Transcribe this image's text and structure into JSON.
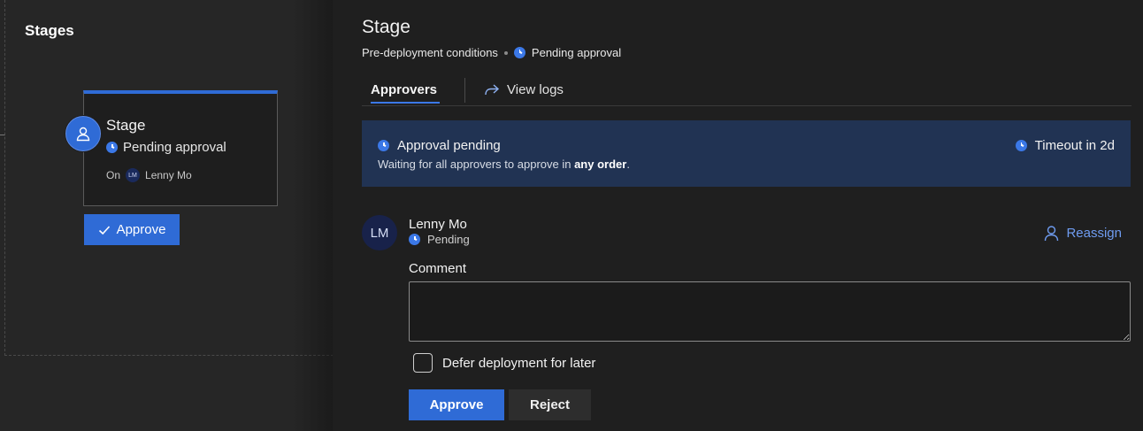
{
  "stages": {
    "title": "Stages",
    "card": {
      "name": "Stage",
      "status": "Pending approval",
      "on_label": "On",
      "user_initials": "LM",
      "user_name": "Lenny Mo"
    },
    "approve_button": "Approve"
  },
  "panel": {
    "title": "Stage",
    "breadcrumb": {
      "conditions": "Pre-deployment conditions",
      "status": "Pending approval"
    },
    "tabs": [
      {
        "label": "Approvers",
        "selected": true
      },
      {
        "label": "View logs",
        "selected": false
      }
    ],
    "banner": {
      "title": "Approval pending",
      "subtitle_prefix": "Waiting for all approvers to approve in ",
      "subtitle_bold": "any order",
      "subtitle_suffix": ".",
      "timeout": "Timeout in 2d"
    },
    "approver": {
      "initials": "LM",
      "name": "Lenny Mo",
      "status": "Pending",
      "reassign": "Reassign"
    },
    "comment": {
      "label": "Comment",
      "value": ""
    },
    "defer_label": "Defer deployment for later",
    "defer_checked": false,
    "actions": {
      "approve": "Approve",
      "reject": "Reject"
    }
  },
  "colors": {
    "accent": "#2f6bd6",
    "banner_bg": "#213353",
    "link": "#6f9cf1",
    "pending_clock": "#3b78e7"
  },
  "icons": {
    "stage_avatar": "person-icon",
    "status": "clock-icon",
    "view_logs": "share-arrow-icon",
    "reassign": "person-icon",
    "approve_check": "checkmark-icon"
  }
}
